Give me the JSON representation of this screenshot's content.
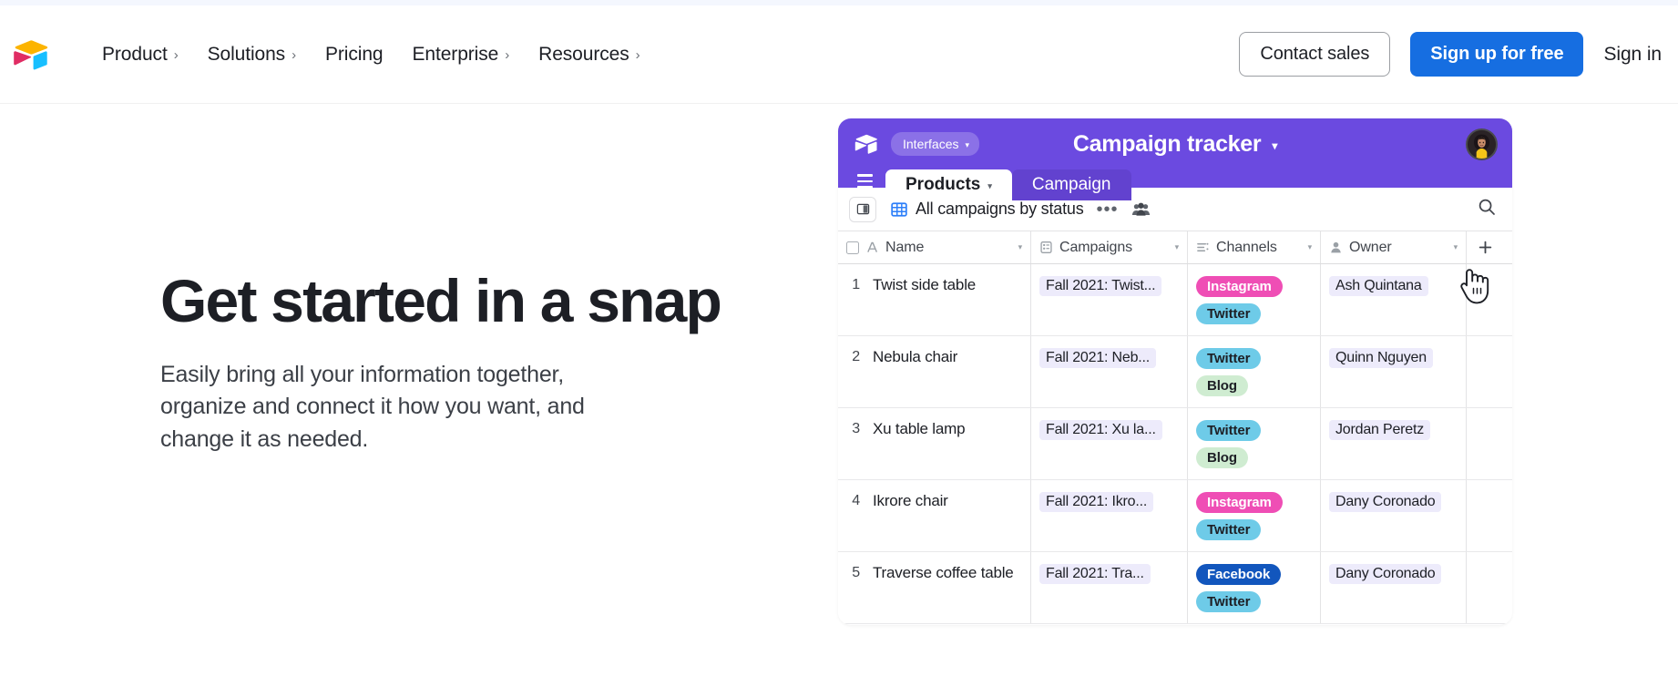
{
  "brand": {
    "logo_icon": "airtable-logo-icon",
    "colors": {
      "yellow": "#FCB400",
      "pink": "#E02D64",
      "blue": "#18BFFF",
      "accent_blue": "#166EE1",
      "app_purple": "#6B4AE0"
    }
  },
  "nav": {
    "links": [
      {
        "label": "Product",
        "has_chevron": true,
        "chevron": "›"
      },
      {
        "label": "Solutions",
        "has_chevron": true,
        "chevron": "›"
      },
      {
        "label": "Pricing",
        "has_chevron": false,
        "chevron": ""
      },
      {
        "label": "Enterprise",
        "has_chevron": true,
        "chevron": "›"
      },
      {
        "label": "Resources",
        "has_chevron": true,
        "chevron": "›"
      }
    ],
    "contact_sales": "Contact sales",
    "sign_up": "Sign up for free",
    "sign_in": "Sign in"
  },
  "hero": {
    "title": "Get started in a snap",
    "subtitle": "Easily bring all your information together, organize and connect it how you want, and change it as needed."
  },
  "app": {
    "header": {
      "logo_icon": "airtable-mark-icon",
      "workspace_pill": "Interfaces",
      "workspace_caret": "▾",
      "title": "Campaign tracker",
      "title_caret": "▾",
      "avatar_icon": "user-avatar"
    },
    "tabs": [
      {
        "label": "Products",
        "active": true,
        "caret": "▾"
      },
      {
        "label": "Campaign",
        "active": false,
        "caret": ""
      }
    ],
    "toolbar": {
      "panel_toggle_icon": "sidebar-toggle-icon",
      "grid_icon": "grid-view-icon",
      "view_name": "All campaigns by status",
      "view_caret": "▾",
      "more_icon": "•••",
      "collaborators_icon": "collaborators-icon",
      "search_icon": "search-icon"
    },
    "grid": {
      "columns": [
        {
          "label": "Name",
          "type_icon": "text-field-icon",
          "caret": "▾",
          "has_checkbox": true
        },
        {
          "label": "Campaigns",
          "type_icon": "linked-record-icon",
          "caret": "▾",
          "has_checkbox": false
        },
        {
          "label": "Channels",
          "type_icon": "multi-select-icon",
          "caret": "▾",
          "has_checkbox": false
        },
        {
          "label": "Owner",
          "type_icon": "collaborator-field-icon",
          "caret": "▾",
          "has_checkbox": false
        }
      ],
      "add_column_label": "+",
      "rows": [
        {
          "num": "1",
          "name": "Twist side table",
          "campaign": "Fall 2021: Twist...",
          "channels": [
            {
              "label": "Instagram",
              "style": "instagram"
            },
            {
              "label": "Twitter",
              "style": "twitter"
            }
          ],
          "owner": "Ash Quintana"
        },
        {
          "num": "2",
          "name": "Nebula chair",
          "campaign": "Fall 2021: Neb...",
          "channels": [
            {
              "label": "Twitter",
              "style": "twitter"
            },
            {
              "label": "Blog",
              "style": "blog"
            }
          ],
          "owner": "Quinn Nguyen"
        },
        {
          "num": "3",
          "name": "Xu table lamp",
          "campaign": "Fall 2021: Xu la...",
          "channels": [
            {
              "label": "Twitter",
              "style": "twitter"
            },
            {
              "label": "Blog",
              "style": "blog"
            }
          ],
          "owner": "Jordan Peretz"
        },
        {
          "num": "4",
          "name": "Ikrore chair",
          "campaign": "Fall 2021: Ikro...",
          "channels": [
            {
              "label": "Instagram",
              "style": "instagram"
            },
            {
              "label": "Twitter",
              "style": "twitter"
            }
          ],
          "owner": "Dany Coronado"
        },
        {
          "num": "5",
          "name": "Traverse coffee table",
          "campaign": "Fall 2021: Tra...",
          "channels": [
            {
              "label": "Facebook",
              "style": "facebook"
            },
            {
              "label": "Twitter",
              "style": "twitter"
            }
          ],
          "owner": "Dany Coronado"
        }
      ]
    },
    "cursor_icon": "pointing-hand-cursor"
  }
}
